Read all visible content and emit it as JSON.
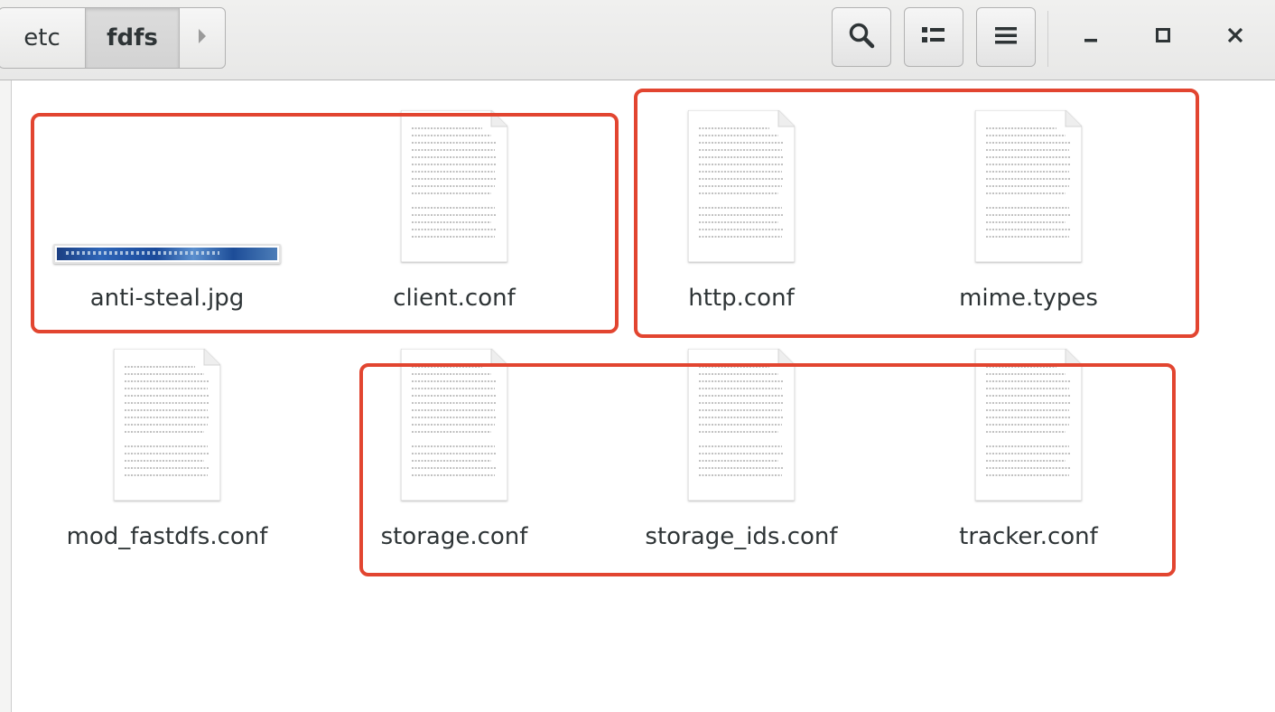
{
  "path_bar": {
    "crumbs": [
      "etc",
      "fdfs"
    ],
    "active_crumb": "fdfs",
    "forward_arrow": "chevron-right-icon"
  },
  "toolbar": {
    "search_icon": "search-icon",
    "view_icon": "list-view-icon",
    "menu_icon": "hamburger-menu-icon"
  },
  "window_controls": {
    "minimize_icon": "minimize-icon",
    "maximize_icon": "maximize-icon",
    "close_icon": "close-icon"
  },
  "files": [
    {
      "name": "anti-steal.jpg",
      "type": "image"
    },
    {
      "name": "client.conf",
      "type": "text"
    },
    {
      "name": "http.conf",
      "type": "text"
    },
    {
      "name": "mime.types",
      "type": "text"
    },
    {
      "name": "mod_fastdfs.conf",
      "type": "text"
    },
    {
      "name": "storage.conf",
      "type": "text"
    },
    {
      "name": "storage_ids.conf",
      "type": "text"
    },
    {
      "name": "tracker.conf",
      "type": "text"
    }
  ],
  "highlight_color": "#e24530"
}
